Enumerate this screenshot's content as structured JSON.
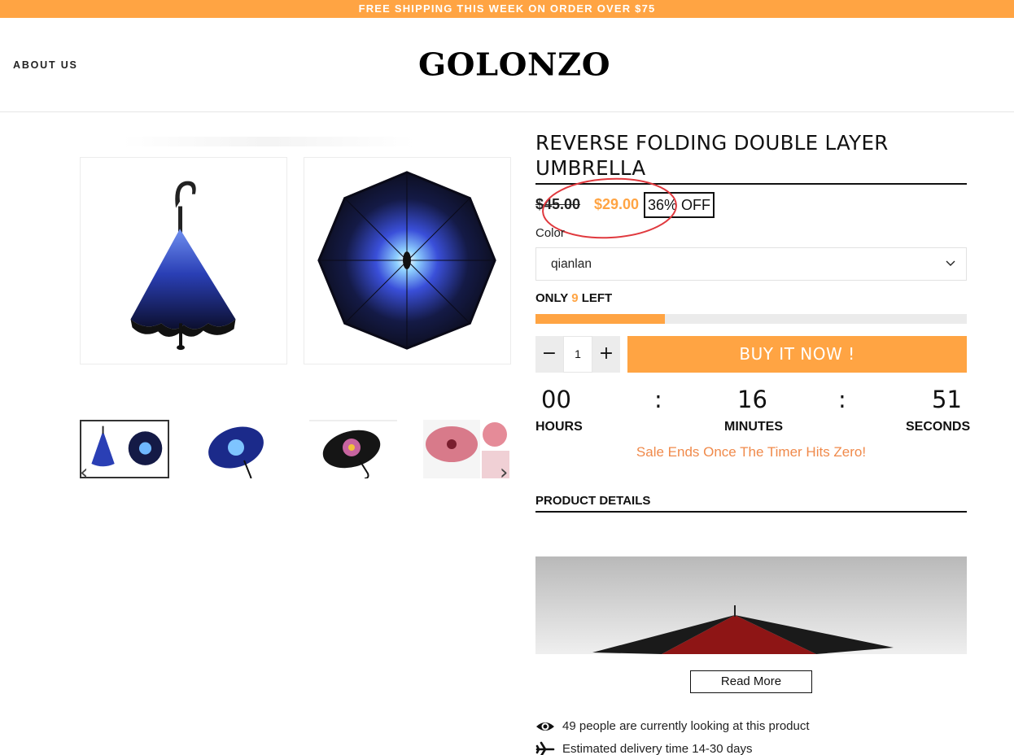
{
  "announcement": "FREE SHIPPING THIS WEEK ON ORDER OVER $75",
  "header": {
    "about_us": "ABOUT US",
    "logo": "GOLONZO"
  },
  "product": {
    "title": "REVERSE FOLDING DOUBLE LAYER UMBRELLA",
    "price_old": "$45.00",
    "price_new": "$29.00",
    "discount": "36% OFF",
    "color_label": "Color",
    "color_value": "qianlan",
    "stock": {
      "prefix": "ONLY",
      "count": "9",
      "suffix": "LEFT",
      "fill_fraction": 0.3
    },
    "quantity": "1",
    "minus_label": "−",
    "plus_label": "+",
    "buy_label": "BUY IT NOW !"
  },
  "timer": {
    "hours": "00",
    "minutes": "16",
    "seconds": "51",
    "separator": ":",
    "hours_label": "HOURS",
    "minutes_label": "MINUTES",
    "seconds_label": "SECONDS",
    "message": "Sale Ends Once The Timer Hits Zero!"
  },
  "details": {
    "heading": "PRODUCT DETAILS",
    "read_more": "Read More",
    "viewers": "49 people are currently looking at this product",
    "delivery": "Estimated delivery time 14-30 days"
  },
  "gallery": {
    "prev_label": "‹",
    "next_label": "›"
  },
  "colors": {
    "accent": "#ffa443",
    "annotation": "#e0393e",
    "text": "#111111"
  },
  "icons": [
    "chevron-down-icon",
    "eye-icon",
    "airplane-icon",
    "chevron-left-icon",
    "chevron-right-icon"
  ]
}
